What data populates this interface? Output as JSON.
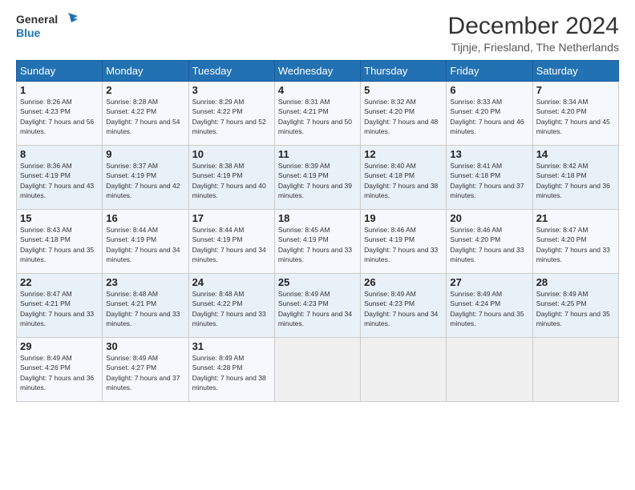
{
  "logo": {
    "line1": "General",
    "line2": "Blue"
  },
  "title": "December 2024",
  "subtitle": "Tijnje, Friesland, The Netherlands",
  "days_header": [
    "Sunday",
    "Monday",
    "Tuesday",
    "Wednesday",
    "Thursday",
    "Friday",
    "Saturday"
  ],
  "weeks": [
    [
      {
        "day": "1",
        "sunrise": "8:26 AM",
        "sunset": "4:23 PM",
        "daylight": "7 hours and 56 minutes."
      },
      {
        "day": "2",
        "sunrise": "8:28 AM",
        "sunset": "4:22 PM",
        "daylight": "7 hours and 54 minutes."
      },
      {
        "day": "3",
        "sunrise": "8:29 AM",
        "sunset": "4:22 PM",
        "daylight": "7 hours and 52 minutes."
      },
      {
        "day": "4",
        "sunrise": "8:31 AM",
        "sunset": "4:21 PM",
        "daylight": "7 hours and 50 minutes."
      },
      {
        "day": "5",
        "sunrise": "8:32 AM",
        "sunset": "4:20 PM",
        "daylight": "7 hours and 48 minutes."
      },
      {
        "day": "6",
        "sunrise": "8:33 AM",
        "sunset": "4:20 PM",
        "daylight": "7 hours and 46 minutes."
      },
      {
        "day": "7",
        "sunrise": "8:34 AM",
        "sunset": "4:20 PM",
        "daylight": "7 hours and 45 minutes."
      }
    ],
    [
      {
        "day": "8",
        "sunrise": "8:36 AM",
        "sunset": "4:19 PM",
        "daylight": "7 hours and 43 minutes."
      },
      {
        "day": "9",
        "sunrise": "8:37 AM",
        "sunset": "4:19 PM",
        "daylight": "7 hours and 42 minutes."
      },
      {
        "day": "10",
        "sunrise": "8:38 AM",
        "sunset": "4:19 PM",
        "daylight": "7 hours and 40 minutes."
      },
      {
        "day": "11",
        "sunrise": "8:39 AM",
        "sunset": "4:19 PM",
        "daylight": "7 hours and 39 minutes."
      },
      {
        "day": "12",
        "sunrise": "8:40 AM",
        "sunset": "4:18 PM",
        "daylight": "7 hours and 38 minutes."
      },
      {
        "day": "13",
        "sunrise": "8:41 AM",
        "sunset": "4:18 PM",
        "daylight": "7 hours and 37 minutes."
      },
      {
        "day": "14",
        "sunrise": "8:42 AM",
        "sunset": "4:18 PM",
        "daylight": "7 hours and 36 minutes."
      }
    ],
    [
      {
        "day": "15",
        "sunrise": "8:43 AM",
        "sunset": "4:18 PM",
        "daylight": "7 hours and 35 minutes."
      },
      {
        "day": "16",
        "sunrise": "8:44 AM",
        "sunset": "4:19 PM",
        "daylight": "7 hours and 34 minutes."
      },
      {
        "day": "17",
        "sunrise": "8:44 AM",
        "sunset": "4:19 PM",
        "daylight": "7 hours and 34 minutes."
      },
      {
        "day": "18",
        "sunrise": "8:45 AM",
        "sunset": "4:19 PM",
        "daylight": "7 hours and 33 minutes."
      },
      {
        "day": "19",
        "sunrise": "8:46 AM",
        "sunset": "4:19 PM",
        "daylight": "7 hours and 33 minutes."
      },
      {
        "day": "20",
        "sunrise": "8:46 AM",
        "sunset": "4:20 PM",
        "daylight": "7 hours and 33 minutes."
      },
      {
        "day": "21",
        "sunrise": "8:47 AM",
        "sunset": "4:20 PM",
        "daylight": "7 hours and 33 minutes."
      }
    ],
    [
      {
        "day": "22",
        "sunrise": "8:47 AM",
        "sunset": "4:21 PM",
        "daylight": "7 hours and 33 minutes."
      },
      {
        "day": "23",
        "sunrise": "8:48 AM",
        "sunset": "4:21 PM",
        "daylight": "7 hours and 33 minutes."
      },
      {
        "day": "24",
        "sunrise": "8:48 AM",
        "sunset": "4:22 PM",
        "daylight": "7 hours and 33 minutes."
      },
      {
        "day": "25",
        "sunrise": "8:49 AM",
        "sunset": "4:23 PM",
        "daylight": "7 hours and 34 minutes."
      },
      {
        "day": "26",
        "sunrise": "8:49 AM",
        "sunset": "4:23 PM",
        "daylight": "7 hours and 34 minutes."
      },
      {
        "day": "27",
        "sunrise": "8:49 AM",
        "sunset": "4:24 PM",
        "daylight": "7 hours and 35 minutes."
      },
      {
        "day": "28",
        "sunrise": "8:49 AM",
        "sunset": "4:25 PM",
        "daylight": "7 hours and 35 minutes."
      }
    ],
    [
      {
        "day": "29",
        "sunrise": "8:49 AM",
        "sunset": "4:26 PM",
        "daylight": "7 hours and 36 minutes."
      },
      {
        "day": "30",
        "sunrise": "8:49 AM",
        "sunset": "4:27 PM",
        "daylight": "7 hours and 37 minutes."
      },
      {
        "day": "31",
        "sunrise": "8:49 AM",
        "sunset": "4:28 PM",
        "daylight": "7 hours and 38 minutes."
      },
      null,
      null,
      null,
      null
    ]
  ]
}
